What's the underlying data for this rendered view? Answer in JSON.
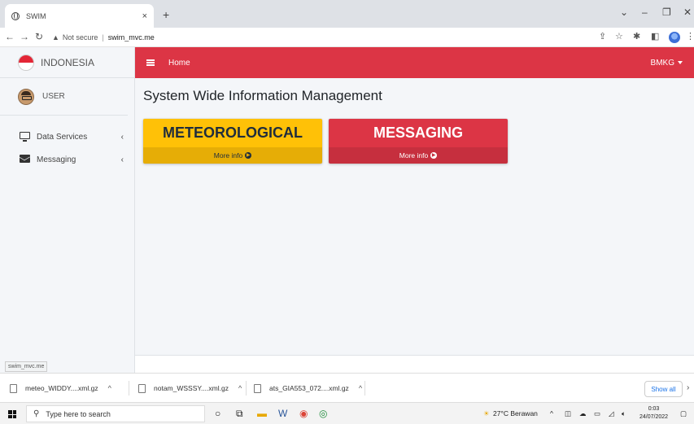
{
  "browser": {
    "tab_title": "SWIM",
    "tab_close": "×",
    "new_tab": "+",
    "security_label": "Not secure",
    "url": "swim_mvc.me",
    "status_url": "swim_mvc.me"
  },
  "sidebar": {
    "brand": "INDONESIA",
    "user": "USER",
    "items": [
      {
        "label": "Data Services"
      },
      {
        "label": "Messaging"
      }
    ]
  },
  "navbar": {
    "home": "Home",
    "account": "BMKG"
  },
  "main": {
    "title": "System Wide Information Management",
    "cards": [
      {
        "title": "METEOROLOGICAL",
        "footer": "More info"
      },
      {
        "title": "MESSAGING",
        "footer": "More info"
      }
    ]
  },
  "downloads": {
    "items": [
      {
        "name": "meteo_WIDDY....xml.gz"
      },
      {
        "name": "notam_WSSSY....xml.gz"
      },
      {
        "name": "ats_GIA553_072....xml.gz"
      }
    ],
    "show_all": "Show all"
  },
  "taskbar": {
    "search_placeholder": "Type here to search",
    "weather": "27°C  Berawan",
    "time": "0:03",
    "date": "24/07/2022"
  },
  "colors": {
    "primary_red": "#dc3545",
    "warning_yellow": "#ffc107",
    "sidebar_bg": "#f4f6f9"
  }
}
